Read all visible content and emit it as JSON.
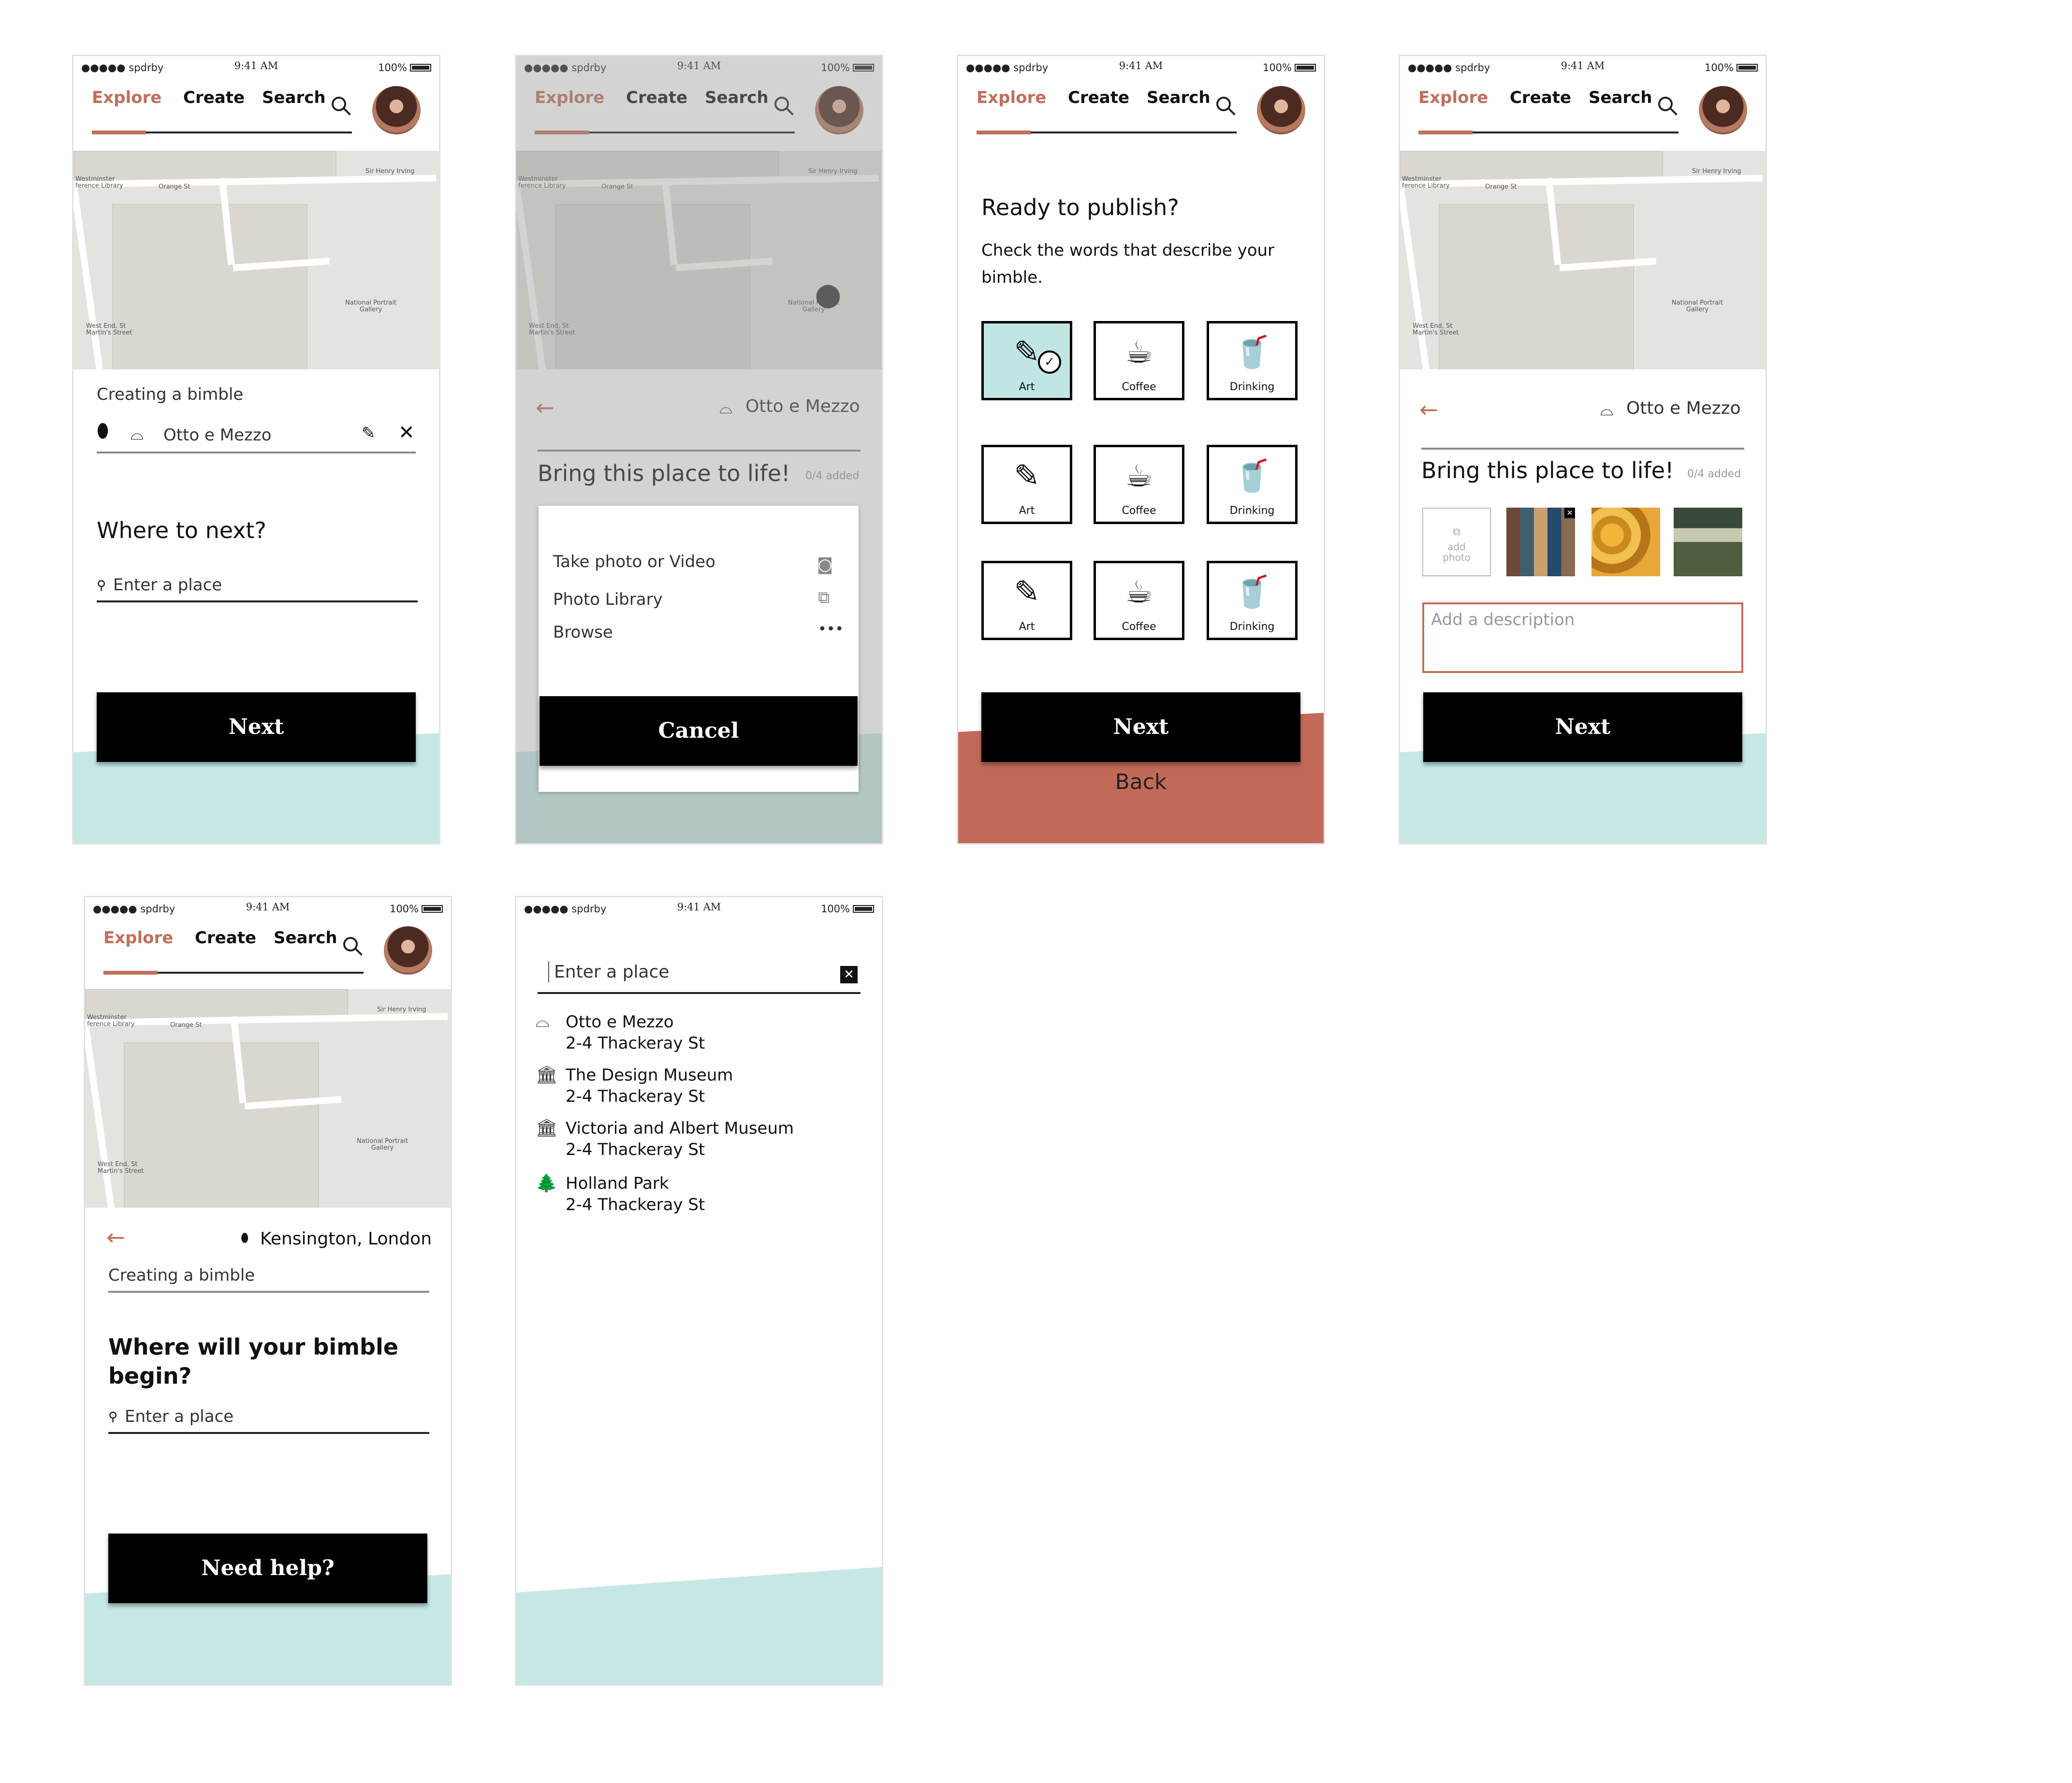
{
  "status_bar": {
    "carrier": "●●●●● spdrby",
    "time": "9:41 AM",
    "battery": "100%"
  },
  "nav": {
    "explore": "Explore",
    "create": "Create",
    "search": "Search"
  },
  "map_labels": {
    "westminster": "Westminster\nference Library",
    "orange_st": "Orange St",
    "sir_henry": "Sir Henry Irving",
    "national_portrait": "National Portrait\nGallery",
    "west_end": "West End, St\nMartin's Street"
  },
  "screen1": {
    "creating_label": "Creating a bimble",
    "place_value": "Otto e Mezzo",
    "heading": "Where to next?",
    "input_placeholder": "Enter a place",
    "next_label": "Next"
  },
  "screen2": {
    "place_name": "Otto e Mezzo",
    "heading": "Bring this place to life!",
    "counter": "0/4 added",
    "sheet": {
      "take_photo": "Take photo or Video",
      "photo_library": "Photo Library",
      "browse": "Browse",
      "cancel": "Cancel"
    }
  },
  "screen3": {
    "heading": "Ready to publish?",
    "subheading": "Check the words that describe your bimble.",
    "tags": [
      "Art",
      "Coffee",
      "Drinking",
      "Art",
      "Coffee",
      "Drinking",
      "Art",
      "Coffee",
      "Drinking"
    ],
    "selected_tag_index": 0,
    "next_label": "Next",
    "back_label": "Back"
  },
  "screen4": {
    "place_name": "Otto e Mezzo",
    "heading": "Bring this place to life!",
    "counter": "0/4 added",
    "add_photo": "add\nphoto",
    "description_placeholder": "Add a description",
    "next_label": "Next"
  },
  "screen5": {
    "location": "Kensington, London",
    "creating_label": "Creating a bimble",
    "heading": "Where will your bimble begin?",
    "input_placeholder": "Enter a place",
    "help_label": "Need help?"
  },
  "screen6": {
    "input_placeholder": "Enter a place",
    "results": [
      {
        "name": "Otto e Mezzo",
        "address": "2-4 Thackeray St",
        "icon": "cloche-icon"
      },
      {
        "name": "The Design Museum",
        "address": "2-4 Thackeray St",
        "icon": "museum-icon"
      },
      {
        "name": "Victoria and Albert Museum",
        "address": "2-4 Thackeray St",
        "icon": "museum-icon"
      },
      {
        "name": "Holland Park",
        "address": "2-4 Thackeray St",
        "icon": "tree-icon"
      }
    ]
  },
  "colors": {
    "accent": "#c0705a",
    "teal": "#c6e8e4",
    "terracotta": "#c26a58",
    "selected_tile": "#bfe6e2"
  }
}
